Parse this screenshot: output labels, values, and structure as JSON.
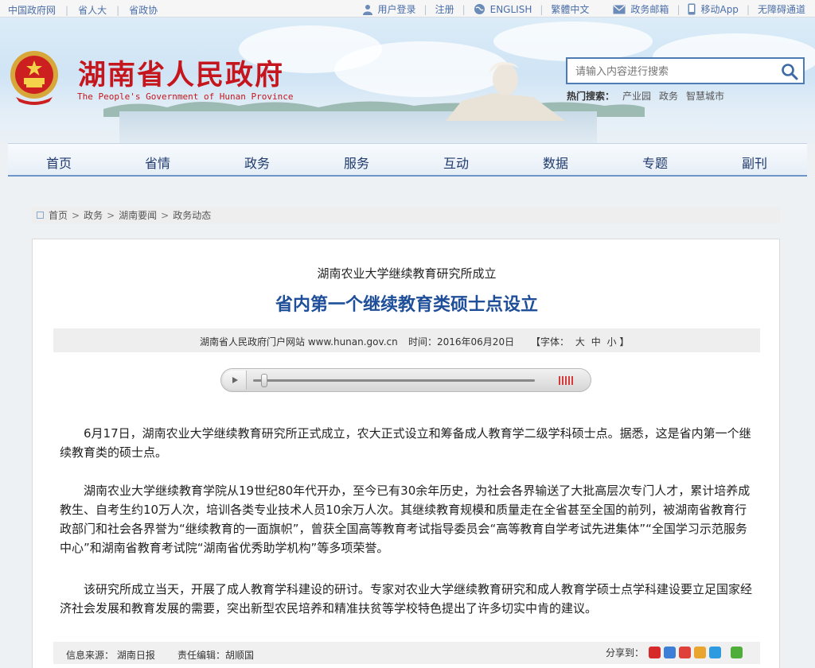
{
  "topbar": {
    "left": [
      "中国政府网",
      "省人大",
      "省政协"
    ],
    "right": [
      {
        "label": "用户登录",
        "icon": "user-icon"
      },
      {
        "label": "注册",
        "icon": ""
      },
      {
        "label": "ENGLISH",
        "icon": "globe-icon"
      },
      {
        "label": "繁體中文",
        "icon": ""
      },
      {
        "label": "政务邮箱",
        "icon": "mail-icon"
      },
      {
        "label": "移动App",
        "icon": "mobile-icon"
      },
      {
        "label": "无障碍通道",
        "icon": ""
      }
    ]
  },
  "header": {
    "title": "湖南省人民政府",
    "subtitle": "The People's Government of Hunan Province",
    "search_placeholder": "请输入内容进行搜索",
    "hot_label": "热门搜索：",
    "hot_items": [
      "产业园",
      "政务",
      "智慧城市"
    ]
  },
  "nav": [
    "首页",
    "省情",
    "政务",
    "服务",
    "互动",
    "数据",
    "专题",
    "副刊"
  ],
  "breadcrumb": [
    "首页",
    "政务",
    "湖南要闻",
    "政务动态"
  ],
  "article": {
    "subtitle": "湖南农业大学继续教育研究所成立",
    "title": "省内第一个继续教育类硕士点设立",
    "source_site": "湖南省人民政府门户网站 www.hunan.gov.cn",
    "time": "时间：2016年06月20日",
    "font_label": "【字体：",
    "font_sizes": [
      "大",
      "中",
      "小"
    ],
    "font_close": "】",
    "paragraphs": [
      "6月17日，湖南农业大学继续教育研究所正式成立，农大正式设立和筹备成人教育学二级学科硕士点。据悉，这是省内第一个继续教育类的硕士点。",
      "湖南农业大学继续教育学院从19世纪80年代开办，至今已有30余年历史，为社会各界输送了大批高层次专门人才，累计培养成教生、自考生约10万人次，培训各类专业技术人员10余万人次。其继续教育规模和质量走在全省甚至全国的前列，被湖南省教育行政部门和社会各界誉为“继续教育的一面旗帜”，曾获全国高等教育考试指导委员会“高等教育自学考试先进集体”“全国学习示范服务中心”和湖南省教育考试院“湖南省优秀助学机构”等多项荣誉。",
      "该研究所成立当天，开展了成人教育学科建设的研讨。专家对农业大学继续教育研究和成人教育学硕士点学科建设要立足国家经济社会发展和教育发展的需要，突出新型农民培养和精准扶贫等学校特色提出了许多切实中肯的建议。"
    ],
    "info_source": "信息来源： 湖南日报",
    "editor": "责任编辑：胡顺国",
    "share_label": "分享到："
  },
  "colors": {
    "brand_red": "#c5161d",
    "title_blue": "#1f4f99",
    "link_blue": "#4a6ea8"
  }
}
